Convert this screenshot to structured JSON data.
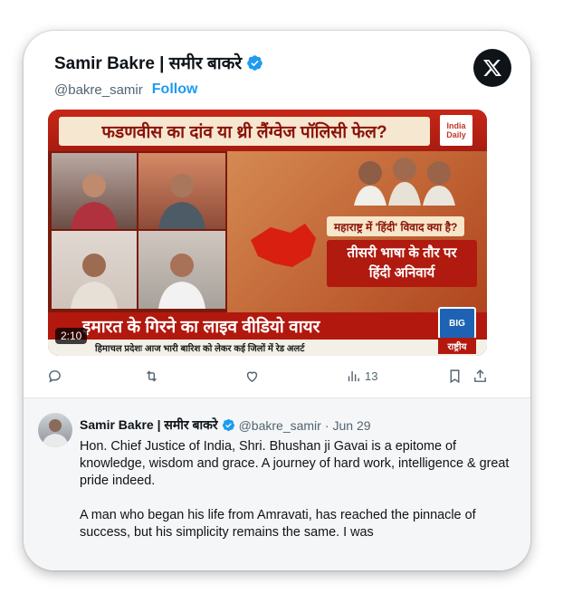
{
  "author": {
    "name": "Samir Bakre | समीर बाकरे",
    "handle": "@bakre_samir",
    "follow_label": "Follow"
  },
  "video": {
    "headline": "फडणवीस का दांव या थ्री लैंग्वेज पॉलिसी फेल?",
    "question": "महाराष्ट्र में 'हिंदी' विवाद क्या है?",
    "caption_line1": "तीसरी भाषा के तौर पर",
    "caption_line2": "हिंदी अनिवार्य",
    "lower_third": "इमारत के गिरने का लाइव वीडियो वायर",
    "ticker": "हिमाचल प्रदेशः आज भारी बारिश को लेकर कई जिलों में रेड अलर्ट",
    "channel_badge": "राष्ट्रीय",
    "logo_top_line1": "India",
    "logo_top_line2": "Daily",
    "logo_bottom": "BIG",
    "duration": "2:10"
  },
  "actions": {
    "views_count": "13"
  },
  "quoted_tweet": {
    "name": "Samir Bakre | समीर बाकरे",
    "handle": "@bakre_samir",
    "separator": "·",
    "date": "Jun 29",
    "paragraph1": "Hon. Chief Justice of India, Shri. Bhushan ji Gavai is a epitome of knowledge, wisdom and grace. A journey of hard work, intelligence & great pride indeed.",
    "paragraph2": "A man who began his life from Amravati, has reached the pinnacle of success, but his simplicity remains the same. I was"
  },
  "colors": {
    "accent": "#1d9bf0",
    "text": "#0f1419",
    "muted": "#536471"
  },
  "icons": [
    "verified-icon",
    "x-logo-icon",
    "reply-icon",
    "retweet-icon",
    "like-icon",
    "views-icon",
    "bookmark-icon",
    "share-icon"
  ]
}
